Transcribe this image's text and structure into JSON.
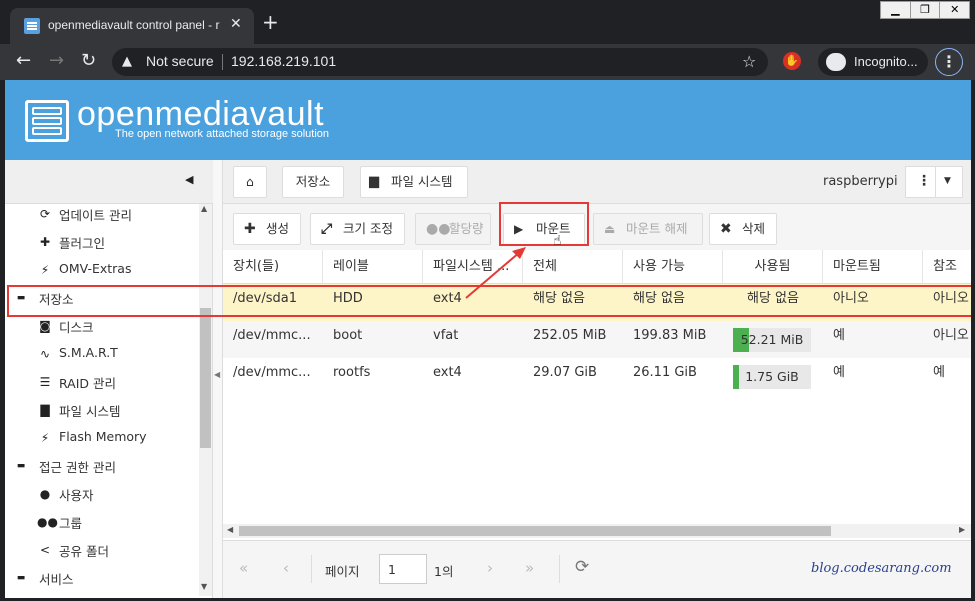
{
  "browser": {
    "tab_title": "openmediavault control panel - r",
    "tab_close": "✕",
    "new_tab": "+",
    "security": "Not secure",
    "url": "192.168.219.101",
    "incognito": "Incognito...",
    "window_controls": [
      "▁",
      "❐",
      "✕"
    ]
  },
  "app": {
    "logo_title": "openmediavault",
    "logo_subtitle": "The open network attached storage solution"
  },
  "sidebar": {
    "items": [
      {
        "label": "업데이트 관리",
        "icon": "refresh-icon",
        "glyph": "⟳",
        "level": "child"
      },
      {
        "label": "플러그인",
        "icon": "puzzle-icon",
        "glyph": "✚",
        "level": "child"
      },
      {
        "label": "OMV-Extras",
        "icon": "plug-icon",
        "glyph": "⚡",
        "level": "child"
      },
      {
        "label": "저장소",
        "icon": "collapse-icon",
        "glyph": "▬",
        "level": "group"
      },
      {
        "label": "디스크",
        "icon": "disk-icon",
        "glyph": "◙",
        "level": "child"
      },
      {
        "label": "S.M.A.R.T",
        "icon": "pulse-icon",
        "glyph": "∿",
        "level": "child"
      },
      {
        "label": "RAID 관리",
        "icon": "database-icon",
        "glyph": "☰",
        "level": "child"
      },
      {
        "label": "파일 시스템",
        "icon": "folder-icon",
        "glyph": "▇",
        "level": "child"
      },
      {
        "label": "Flash Memory",
        "icon": "flash-icon",
        "glyph": "⚡",
        "level": "child"
      },
      {
        "label": "접근 권한 관리",
        "icon": "collapse-icon",
        "glyph": "▬",
        "level": "group"
      },
      {
        "label": "사용자",
        "icon": "user-icon",
        "glyph": "●",
        "level": "child"
      },
      {
        "label": "그룹",
        "icon": "group-icon",
        "glyph": "●●",
        "level": "child"
      },
      {
        "label": "공유 폴더",
        "icon": "share-icon",
        "glyph": "<",
        "level": "child"
      },
      {
        "label": "서비스",
        "icon": "collapse-icon",
        "glyph": "▬",
        "level": "group"
      }
    ]
  },
  "breadcrumb": {
    "storage": "저장소",
    "filesystem": "파일 시스템",
    "hostname": "raspberrypi"
  },
  "actions": {
    "create": "생성",
    "resize": "크기 조정",
    "quota": "할당량",
    "mount": "마운트",
    "unmount": "마운트 해제",
    "delete": "삭제"
  },
  "grid": {
    "columns": [
      "장치(들)",
      "레이블",
      "파일시스템 ...",
      "전체",
      "사용 가능",
      "사용됨",
      "마운트됨",
      "참조"
    ],
    "rows": [
      {
        "device": "/dev/sda1",
        "label": "HDD",
        "fs": "ext4",
        "total": "해당 없음",
        "available": "해당 없음",
        "used": "해당 없음",
        "used_fraction": null,
        "mounted": "아니오",
        "referenced": "아니오"
      },
      {
        "device": "/dev/mmc...",
        "label": "boot",
        "fs": "vfat",
        "total": "252.05 MiB",
        "available": "199.83 MiB",
        "used": "52.21 MiB",
        "used_fraction": 0.21,
        "mounted": "예",
        "referenced": "아니오"
      },
      {
        "device": "/dev/mmc...",
        "label": "rootfs",
        "fs": "ext4",
        "total": "29.07 GiB",
        "available": "26.11 GiB",
        "used": "1.75 GiB",
        "used_fraction": 0.06,
        "mounted": "예",
        "referenced": "예"
      }
    ]
  },
  "pager": {
    "page_label": "페이지",
    "page_value": "1",
    "of_label": "1의"
  },
  "watermark": "blog.codesarang.com",
  "colors": {
    "header": "#4aa1dd",
    "selected_row": "#fdf5c8",
    "highlight": "#e53935",
    "usage_fill": "#4caf50"
  }
}
